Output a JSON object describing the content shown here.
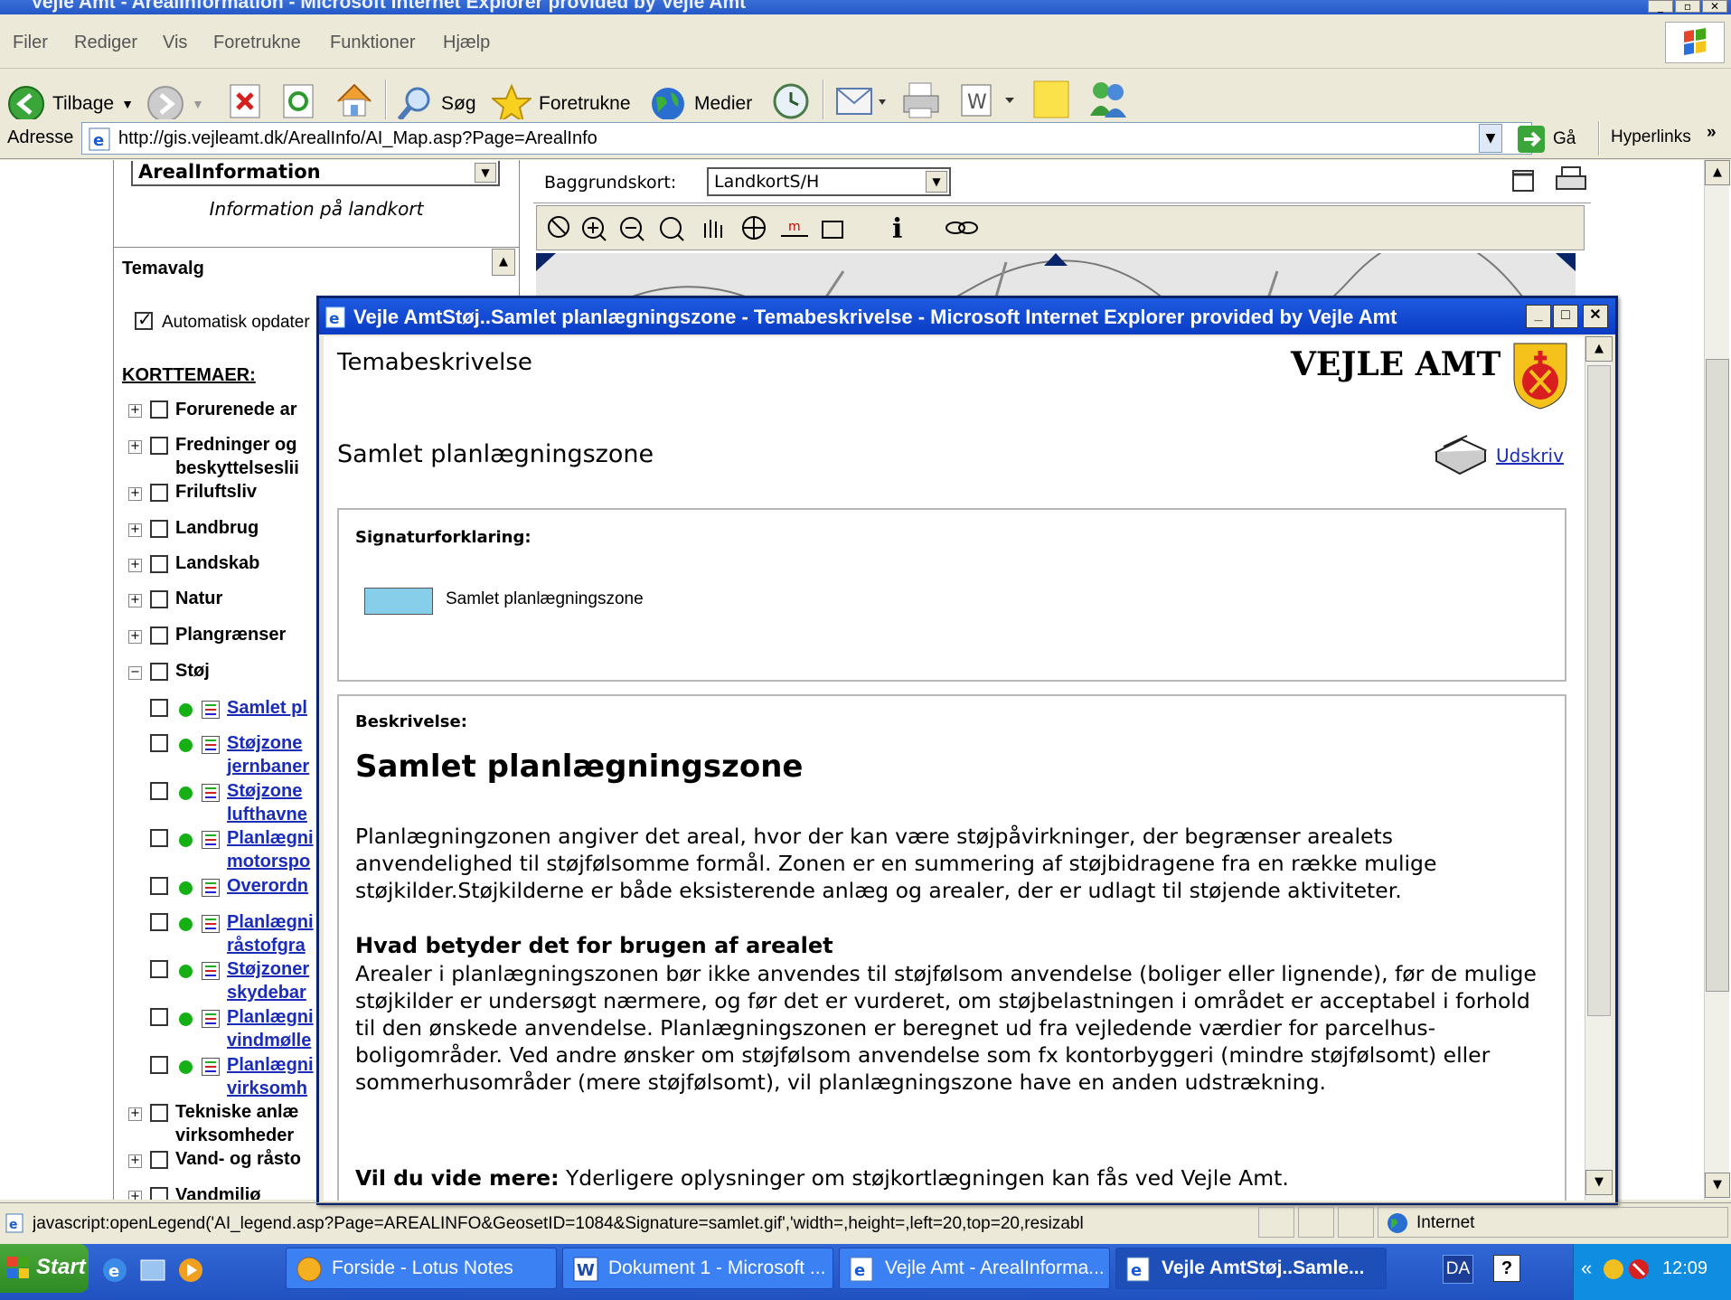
{
  "window": {
    "title": "Vejle Amt - ArealInformation - Microsoft Internet Explorer provided by Vejle Amt"
  },
  "menu": [
    "Filer",
    "Rediger",
    "Vis",
    "Foretrukne",
    "Funktioner",
    "Hjælp"
  ],
  "toolbar": {
    "back": "Tilbage",
    "search": "Søg",
    "favorites": "Foretrukne",
    "media": "Medier"
  },
  "address": {
    "label": "Adresse",
    "url": "http://gis.vejleamt.dk/ArealInfo/AI_Map.asp?Page=ArealInfo",
    "go": "Gå",
    "links": "Hyperlinks"
  },
  "left": {
    "dropdown": "ArealInformation",
    "subtitle": "Information på landkort",
    "temavalg": "Temavalg",
    "auto_update": "Automatisk opdater",
    "korttemaer": "KORTTEMAER:",
    "groups": [
      "Forurenede ar",
      "Fredninger og",
      "beskyttelseslii",
      "Friluftsliv",
      "Landbrug",
      "Landskab",
      "Natur",
      "Plangrænser",
      "Støj"
    ],
    "layers": [
      "Samlet pl",
      "Støjzone",
      "jernbaner",
      "Støjzone",
      "lufthavne",
      "Planlægni",
      "motorspo",
      "Overordn",
      "Planlægni",
      "råstofgra",
      "Støjzoner",
      "skydebar",
      "Planlægni",
      "vindmølle",
      "Planlægni",
      "virksomh"
    ],
    "groups2": [
      "Tekniske anlæ",
      "virksomheder",
      "Vand- og råsto",
      "Vandmiljø"
    ]
  },
  "map": {
    "baggrund_label": "Baggrundskort:",
    "baggrund_value": "LandkortS/H"
  },
  "popup": {
    "title": "Vejle AmtStøj..Samlet planlægningszone - Temabeskrivelse - Microsoft Internet Explorer provided by Vejle Amt",
    "heading": "Temabeskrivelse",
    "logo": "VEJLE AMT",
    "zone_title": "Samlet planlægningszone",
    "print": "Udskriv",
    "sig_label": "Signaturforklaring:",
    "legend_label": "Samlet planlægningszone",
    "legend_color": "#87ceeb",
    "desc_label": "Beskrivelse:",
    "desc_title": "Samlet planlægningszone",
    "para1": "Planlægningzonen angiver det areal, hvor der kan være støjpåvirkninger, der begrænser arealets anvendelighed til støjfølsomme formål. Zonen er en summering af støjbidragene fra en række mulige støjkilder.Støjkilderne er både eksisterende anlæg og arealer, der er udlagt til støjende aktiviteter.",
    "h2": "Hvad betyder det for brugen af arealet",
    "para2": "Arealer i planlægningszonen bør ikke anvendes til støjfølsom anvendelse (boliger eller lignende), før de mulige støjkilder er undersøgt nærmere, og før det er vurderet, om støjbelastningen i området er acceptabel i forhold til den ønskede anvendelse. Planlægningszonen er beregnet ud fra vejledende værdier for parcelhus-boligområder. Ved andre ønsker om støjfølsom anvendelse som fx kontorbyggeri (mindre støjfølsomt) eller sommerhusområder (mere støjfølsomt), vil planlægningszone have en anden udstrækning.",
    "more_bold": "Vil du vide mere:",
    "more_text": "Yderligere oplysninger om støjkortlægningen kan fås ved Vejle Amt."
  },
  "status": {
    "text": "javascript:openLegend('AI_legend.asp?Page=AREALINFO&GeosetID=1084&Signature=samlet.gif','width=,height=,left=20,top=20,resizabl",
    "zone": "Internet"
  },
  "taskbar": {
    "start": "Start",
    "tasks": [
      "Forside - Lotus Notes",
      "Dokument 1 - Microsoft ...",
      "Vejle Amt - ArealInforma...",
      "Vejle AmtStøj..Samle..."
    ],
    "lang": "DA",
    "clock": "12:09"
  }
}
